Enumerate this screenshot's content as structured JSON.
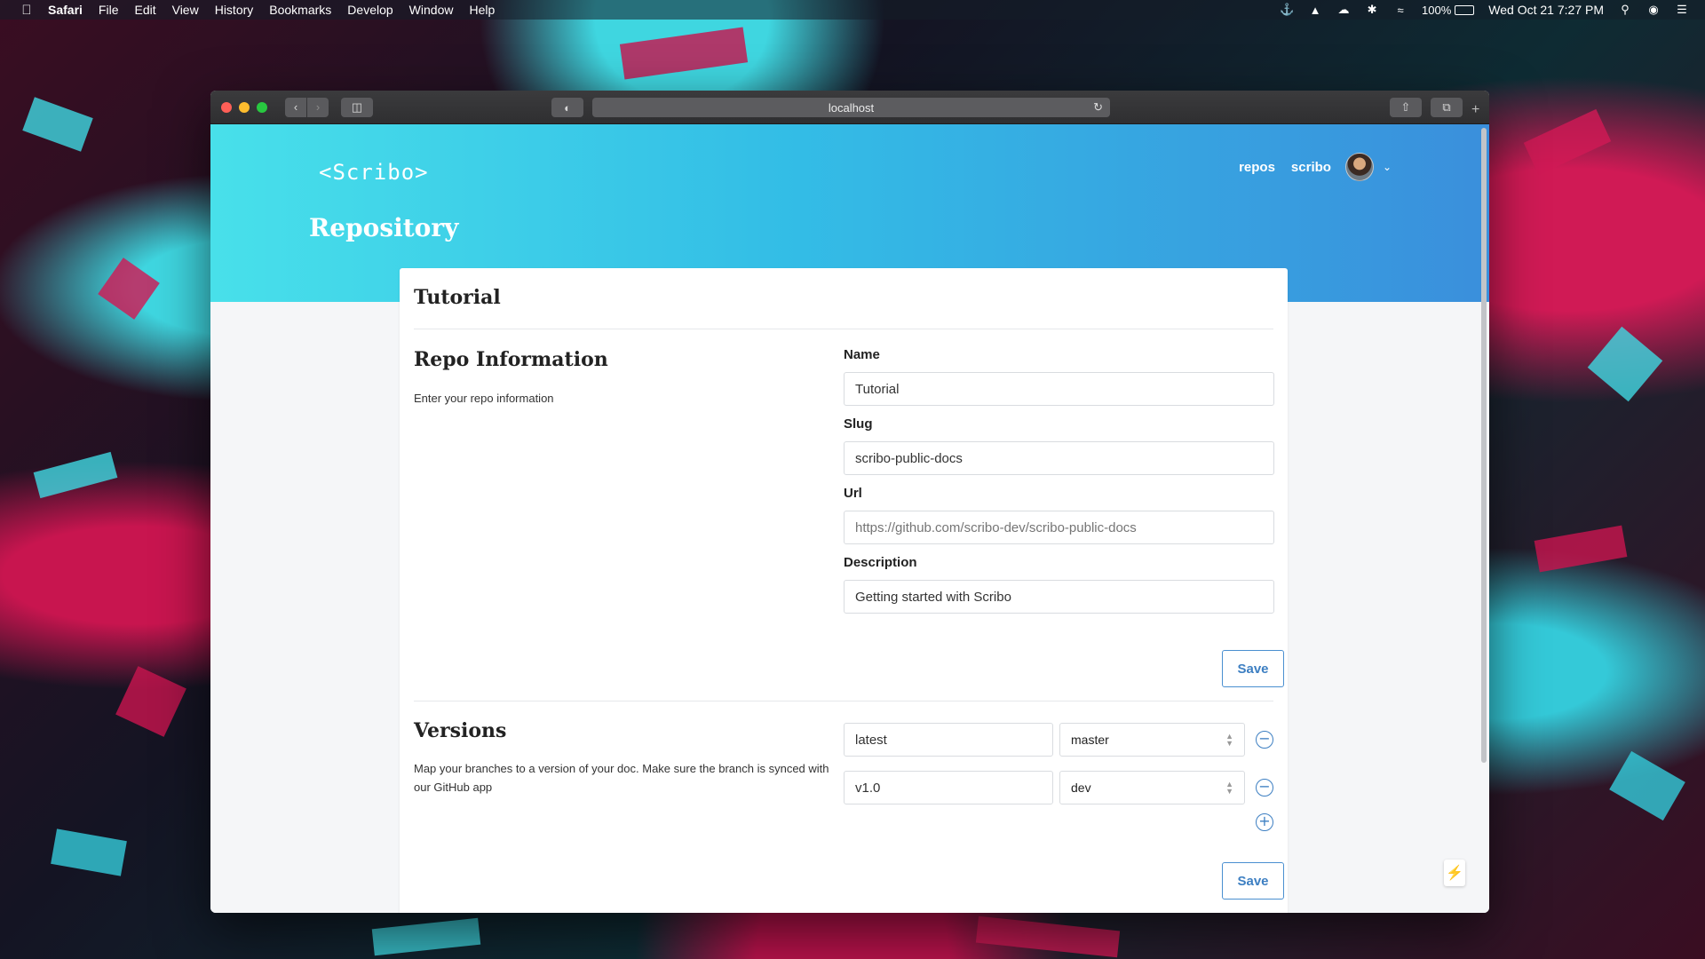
{
  "menubar": {
    "app": "Safari",
    "items": [
      "File",
      "Edit",
      "View",
      "History",
      "Bookmarks",
      "Develop",
      "Window",
      "Help"
    ],
    "battery": "100%",
    "clock": "Wed Oct 21  7:27 PM"
  },
  "browser": {
    "url": "localhost"
  },
  "site": {
    "logo": "<Scribo>",
    "nav": {
      "repos": "repos",
      "user": "scribo"
    },
    "page_title": "Repository"
  },
  "card": {
    "title": "Tutorial",
    "repo_info": {
      "title": "Repo Information",
      "description": "Enter your repo information",
      "fields": {
        "name": {
          "label": "Name",
          "value": "Tutorial"
        },
        "slug": {
          "label": "Slug",
          "value": "scribo-public-docs"
        },
        "url": {
          "label": "Url",
          "placeholder": "https://github.com/scribo-dev/scribo-public-docs"
        },
        "description": {
          "label": "Description",
          "value": "Getting started with Scribo"
        }
      },
      "save_label": "Save"
    },
    "versions": {
      "title": "Versions",
      "description": "Map your branches to a version of your doc. Make sure the branch is synced with our GitHub app",
      "rows": [
        {
          "version": "latest",
          "branch": "master"
        },
        {
          "version": "v1.0",
          "branch": "dev"
        }
      ],
      "save_label": "Save"
    }
  },
  "colors": {
    "accent": "#3d7fc2",
    "hero_start": "#48e0ea",
    "hero_end": "#3a8fdc"
  }
}
